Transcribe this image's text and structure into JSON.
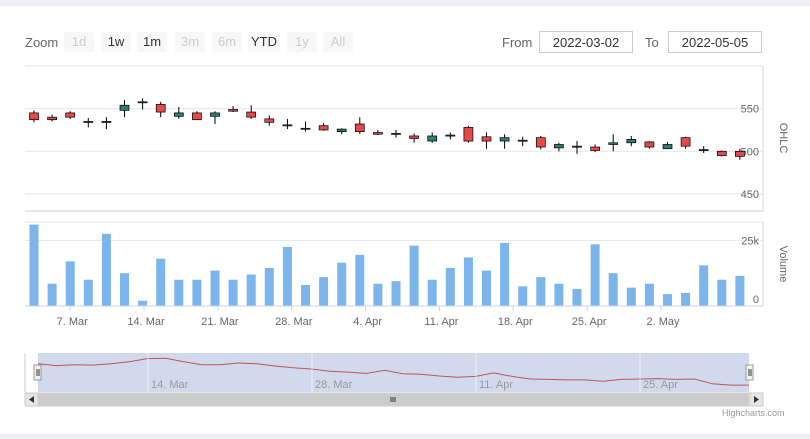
{
  "rangeSelector": {
    "zoom_label": "Zoom",
    "buttons": [
      {
        "label": "1d",
        "enabled": false
      },
      {
        "label": "1w",
        "enabled": true
      },
      {
        "label": "1m",
        "enabled": true
      },
      {
        "label": "3m",
        "enabled": false
      },
      {
        "label": "6m",
        "enabled": false
      },
      {
        "label": "YTD",
        "enabled": true
      },
      {
        "label": "1y",
        "enabled": false
      },
      {
        "label": "All",
        "enabled": false
      }
    ],
    "from_label": "From",
    "from_value": "2022-03-02",
    "to_label": "To",
    "to_value": "2022-05-05"
  },
  "credits": "Highcharts.com",
  "colors": {
    "up": "#2f7e6f",
    "down": "#e04a4a",
    "volume": "#7cb5ec",
    "navigator_line": "#c0545c",
    "navigator_mask": "#ccd6eb"
  },
  "chart_data": {
    "type": "candlestick",
    "ohlc_axis": {
      "label": "OHLC",
      "ticks": [
        450,
        500,
        550
      ],
      "range": [
        430,
        600
      ]
    },
    "volume_axis": {
      "label": "Volume",
      "ticks": [
        0,
        25000
      ],
      "tick_labels": [
        "0",
        "25k"
      ],
      "range": [
        0,
        32000
      ]
    },
    "x_ticks": [
      "7. Mar",
      "14. Mar",
      "21. Mar",
      "28. Mar",
      "4. Apr",
      "11. Apr",
      "18. Apr",
      "25. Apr",
      "2. May"
    ],
    "navigator_ticks": [
      "14. Mar",
      "28. Mar",
      "11. Apr",
      "25. Apr"
    ],
    "candles": [
      {
        "o": 545,
        "h": 548,
        "l": 534,
        "c": 537
      },
      {
        "o": 540,
        "h": 543,
        "l": 535,
        "c": 537
      },
      {
        "o": 545,
        "h": 547,
        "l": 538,
        "c": 540
      },
      {
        "o": 535,
        "h": 539,
        "l": 528,
        "c": 535
      },
      {
        "o": 535,
        "h": 540,
        "l": 526,
        "c": 535
      },
      {
        "o": 548,
        "h": 560,
        "l": 540,
        "c": 554
      },
      {
        "o": 558,
        "h": 562,
        "l": 549,
        "c": 558
      },
      {
        "o": 555,
        "h": 558,
        "l": 540,
        "c": 546
      },
      {
        "o": 541,
        "h": 552,
        "l": 538,
        "c": 545
      },
      {
        "o": 545,
        "h": 547,
        "l": 537,
        "c": 537
      },
      {
        "o": 541,
        "h": 547,
        "l": 532,
        "c": 545
      },
      {
        "o": 549,
        "h": 553,
        "l": 546,
        "c": 547
      },
      {
        "o": 546,
        "h": 554,
        "l": 538,
        "c": 540
      },
      {
        "o": 538,
        "h": 542,
        "l": 530,
        "c": 534
      },
      {
        "o": 531,
        "h": 538,
        "l": 526,
        "c": 531
      },
      {
        "o": 527,
        "h": 535,
        "l": 523,
        "c": 527
      },
      {
        "o": 530,
        "h": 533,
        "l": 524,
        "c": 525
      },
      {
        "o": 523,
        "h": 527,
        "l": 520,
        "c": 526
      },
      {
        "o": 532,
        "h": 540,
        "l": 520,
        "c": 523
      },
      {
        "o": 522,
        "h": 525,
        "l": 519,
        "c": 520
      },
      {
        "o": 521,
        "h": 525,
        "l": 516,
        "c": 521
      },
      {
        "o": 518,
        "h": 521,
        "l": 510,
        "c": 515
      },
      {
        "o": 512,
        "h": 522,
        "l": 510,
        "c": 518
      },
      {
        "o": 519,
        "h": 522,
        "l": 514,
        "c": 519
      },
      {
        "o": 528,
        "h": 530,
        "l": 510,
        "c": 512
      },
      {
        "o": 517,
        "h": 522,
        "l": 503,
        "c": 512
      },
      {
        "o": 512,
        "h": 520,
        "l": 503,
        "c": 516
      },
      {
        "o": 513,
        "h": 517,
        "l": 506,
        "c": 513
      },
      {
        "o": 516,
        "h": 518,
        "l": 502,
        "c": 505
      },
      {
        "o": 504,
        "h": 510,
        "l": 500,
        "c": 508
      },
      {
        "o": 506,
        "h": 512,
        "l": 497,
        "c": 506
      },
      {
        "o": 505,
        "h": 508,
        "l": 499,
        "c": 501
      },
      {
        "o": 508,
        "h": 520,
        "l": 500,
        "c": 510
      },
      {
        "o": 510,
        "h": 518,
        "l": 506,
        "c": 514
      },
      {
        "o": 511,
        "h": 512,
        "l": 503,
        "c": 505
      },
      {
        "o": 503,
        "h": 511,
        "l": 503,
        "c": 508
      },
      {
        "o": 516,
        "h": 517,
        "l": 503,
        "c": 506
      },
      {
        "o": 502,
        "h": 506,
        "l": 498,
        "c": 502
      },
      {
        "o": 500,
        "h": 501,
        "l": 494,
        "c": 495
      },
      {
        "o": 500,
        "h": 503,
        "l": 490,
        "c": 494
      }
    ],
    "volume": [
      31000,
      8500,
      17000,
      10000,
      27500,
      12500,
      2000,
      18000,
      10000,
      10000,
      13500,
      10000,
      12000,
      14500,
      22500,
      8000,
      11000,
      16500,
      19500,
      8500,
      9500,
      23000,
      10000,
      14500,
      18500,
      13500,
      24000,
      7500,
      11000,
      8500,
      6500,
      23500,
      12500,
      7000,
      8500,
      4500,
      5000,
      15500,
      10000,
      11500
    ],
    "navigator": [
      545,
      541,
      543,
      542,
      545,
      550,
      557,
      558,
      550,
      543,
      543,
      547,
      545,
      540,
      536,
      533,
      528,
      526,
      523,
      530,
      522,
      521,
      517,
      514,
      516,
      524,
      516,
      510,
      509,
      508,
      508,
      505,
      509,
      510,
      511,
      509,
      510,
      499,
      496,
      496
    ]
  }
}
